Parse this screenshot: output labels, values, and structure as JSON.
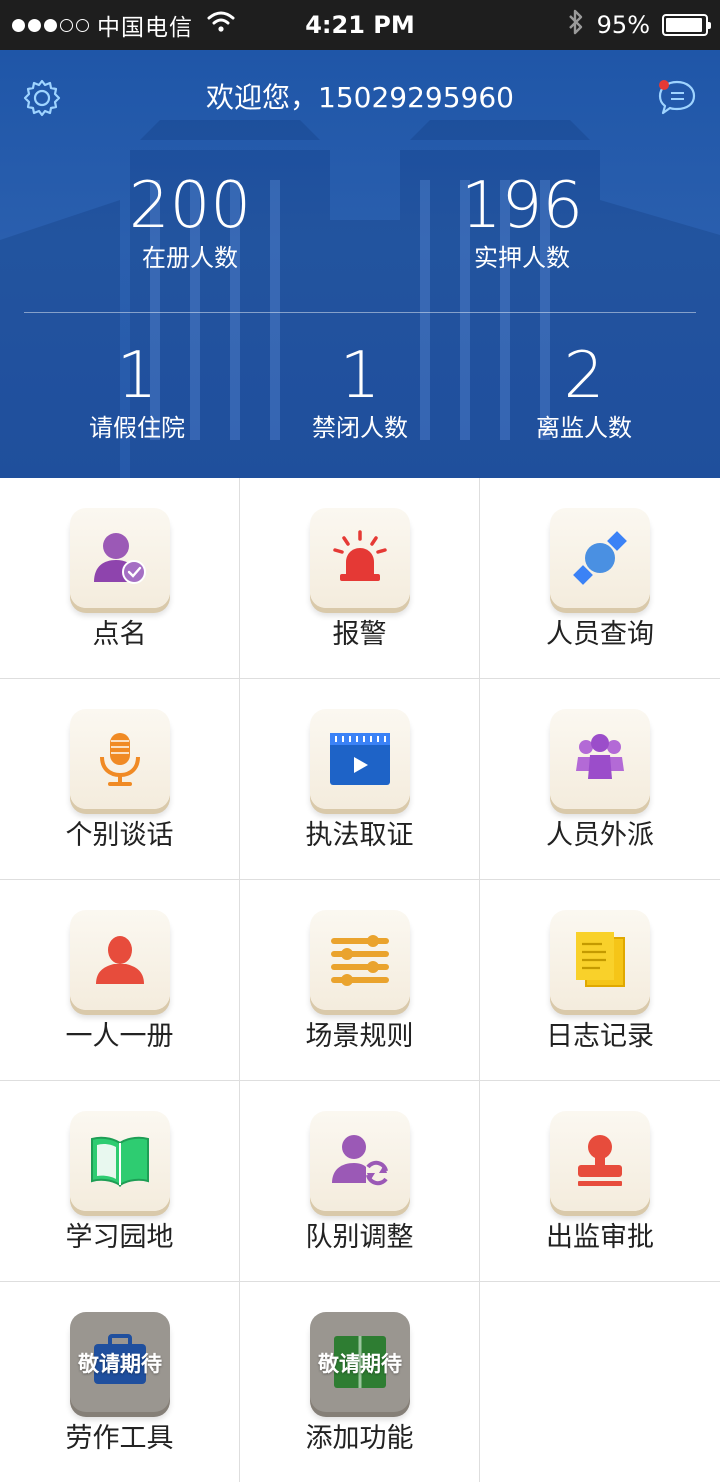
{
  "status_bar": {
    "carrier": "中国电信",
    "time": "4:21 PM",
    "battery_percent": "95%",
    "battery_level": 0.95,
    "signal_filled": 3,
    "signal_total": 5
  },
  "header": {
    "welcome": "欢迎您，15029295960",
    "stats_top": [
      {
        "value": "200",
        "label": "在册人数"
      },
      {
        "value": "196",
        "label": "实押人数"
      }
    ],
    "stats_bottom": [
      {
        "value": "1",
        "label": "请假住院"
      },
      {
        "value": "1",
        "label": "禁闭人数"
      },
      {
        "value": "2",
        "label": "离监人数"
      }
    ],
    "colors": {
      "background": "#2659aa",
      "notification_dot": "#e53935"
    }
  },
  "grid": {
    "items": [
      {
        "label": "点名",
        "icon": "user-check-icon"
      },
      {
        "label": "报警",
        "icon": "alarm-siren-icon"
      },
      {
        "label": "人员查询",
        "icon": "search-person-icon"
      },
      {
        "label": "个别谈话",
        "icon": "microphone-icon"
      },
      {
        "label": "执法取证",
        "icon": "video-clapper-icon"
      },
      {
        "label": "人员外派",
        "icon": "group-people-icon"
      },
      {
        "label": "一人一册",
        "icon": "person-profile-icon"
      },
      {
        "label": "场景规则",
        "icon": "slider-rules-icon"
      },
      {
        "label": "日志记录",
        "icon": "notebook-log-icon"
      },
      {
        "label": "学习园地",
        "icon": "open-book-icon"
      },
      {
        "label": "队别调整",
        "icon": "user-refresh-icon"
      },
      {
        "label": "出监审批",
        "icon": "approval-stamp-icon"
      },
      {
        "label": "劳作工具",
        "icon": "toolbox-icon",
        "badge": "敬请期待"
      },
      {
        "label": "添加功能",
        "icon": "add-feature-icon",
        "badge": "敬请期待"
      }
    ]
  }
}
